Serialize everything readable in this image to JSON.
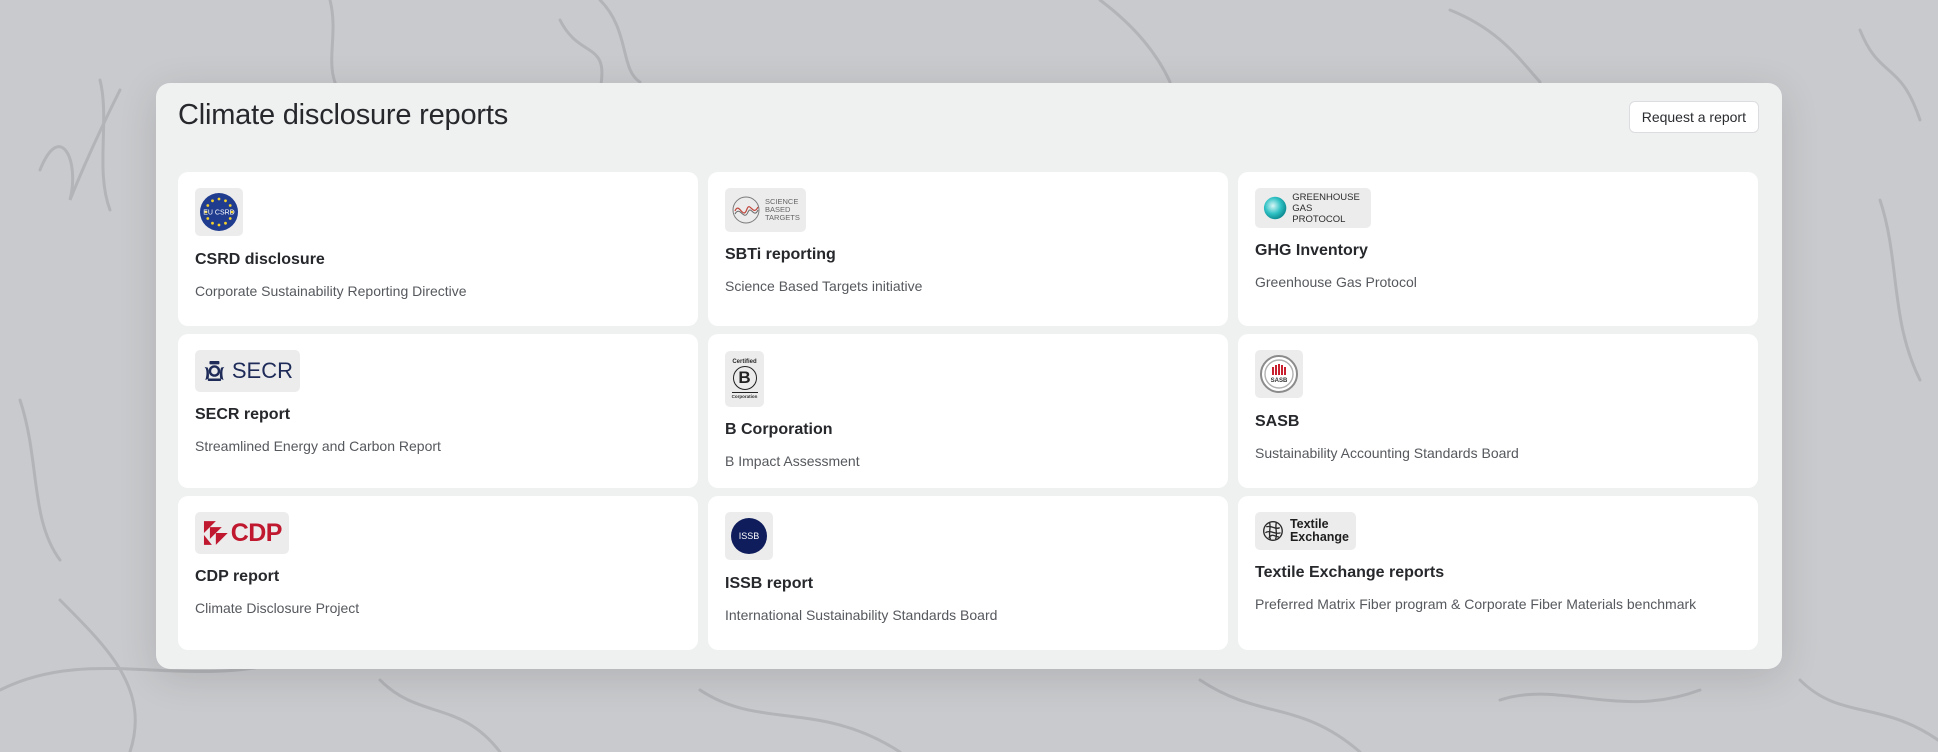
{
  "page": {
    "title": "Climate disclosure reports",
    "request_button": "Request a report"
  },
  "colors": {
    "background": "#c9cacd",
    "panel": "#eff0f0",
    "card": "#ffffff",
    "title_text": "#26282c",
    "subtitle_text": "#55585d",
    "eu_blue": "#1f3c8f",
    "cdp_red": "#c0182f",
    "issb_navy": "#0f1d5c",
    "secr_navy": "#1e2b58",
    "ghg_teal": "#19b3b7"
  },
  "cards": [
    {
      "id": "csrd",
      "title": "CSRD disclosure",
      "subtitle": "Corporate Sustainability Reporting Directive",
      "logo": "eu-csrd-logo",
      "logo_text": "EU CSRD"
    },
    {
      "id": "sbti",
      "title": "SBTi reporting",
      "subtitle": "Science Based Targets initiative",
      "logo": "sbti-logo",
      "logo_text": [
        "SCIENCE",
        "BASED",
        "TARGETS"
      ]
    },
    {
      "id": "ghg",
      "title": "GHG Inventory",
      "subtitle": "Greenhouse Gas Protocol",
      "logo": "ghg-protocol-logo",
      "logo_text": [
        "GREENHOUSE",
        "GAS PROTOCOL"
      ]
    },
    {
      "id": "secr",
      "title": "SECR report",
      "subtitle": "Streamlined Energy and Carbon Report",
      "logo": "secr-logo",
      "logo_text": "SECR"
    },
    {
      "id": "bcorp",
      "title": "B Corporation",
      "subtitle": "B Impact Assessment",
      "logo": "b-corp-logo",
      "logo_text": [
        "Certified",
        "B",
        "Corporation"
      ]
    },
    {
      "id": "sasb",
      "title": "SASB",
      "subtitle": "Sustainability Accounting Standards Board",
      "logo": "sasb-logo",
      "logo_text": "SASB"
    },
    {
      "id": "cdp",
      "title": "CDP report",
      "subtitle": "Climate Disclosure Project",
      "logo": "cdp-logo",
      "logo_text": "CDP"
    },
    {
      "id": "issb",
      "title": "ISSB report",
      "subtitle": "International Sustainability Standards Board",
      "logo": "issb-logo",
      "logo_text": "ISSB"
    },
    {
      "id": "textile",
      "title": "Textile Exchange reports",
      "subtitle": "Preferred Matrix Fiber program & Corporate Fiber Materials benchmark",
      "logo": "textile-exchange-logo",
      "logo_text": [
        "Textile",
        "Exchange"
      ]
    }
  ]
}
